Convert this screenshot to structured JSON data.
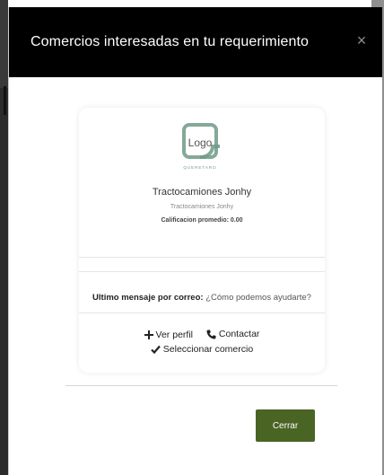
{
  "modal": {
    "title": "Comercios interesadas en tu requerimiento",
    "close_symbol": "×"
  },
  "card": {
    "logo_text": "Logo",
    "logo_caption": "QUERETARO",
    "business_name": "Tractocamiones Jonhy",
    "business_subtitle": "Tractocamiones Jonhy",
    "rating_label": "Calificacion promedio: 0.00",
    "message_label": "Ultimo mensaje por correo:",
    "message_value": "¿Cómo podemos ayudarte?",
    "actions": {
      "view_profile": "Ver perfil",
      "contact": "Contactar",
      "select": "Seleccionar comercio"
    },
    "icons": {
      "view_profile": "plus-icon",
      "contact": "phone-icon",
      "select": "check-icon"
    }
  },
  "footer": {
    "close_label": "Cerrar"
  },
  "colors": {
    "header_bg": "#000000",
    "accent_green": "#4a6424",
    "logo_green": "#6f9a86"
  }
}
